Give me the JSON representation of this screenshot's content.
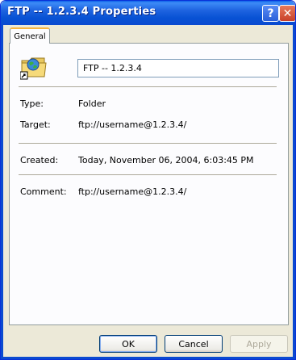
{
  "window": {
    "title": "FTP -- 1.2.3.4 Properties",
    "help_glyph": "?",
    "close_glyph": "✕"
  },
  "tabs": [
    {
      "label": "General",
      "selected": true
    }
  ],
  "general": {
    "icon": "ftp-folder-shortcut-icon",
    "name_value": "FTP -- 1.2.3.4",
    "rows": [
      {
        "label": "Type:",
        "value": "Folder"
      },
      {
        "label": "Target:",
        "value": "ftp://username@1.2.3.4/"
      },
      {
        "label": "Created:",
        "value": "Today, November 06, 2004, 6:03:45 PM"
      },
      {
        "label": "Comment:",
        "value": "ftp://username@1.2.3.4/"
      }
    ]
  },
  "buttons": {
    "ok": "OK",
    "cancel": "Cancel",
    "apply": "Apply",
    "apply_enabled": false
  },
  "colors": {
    "titlebar": "#0a5fe8",
    "dialog_face": "#ece9d8",
    "tab_highlight": "#f8b53e"
  }
}
